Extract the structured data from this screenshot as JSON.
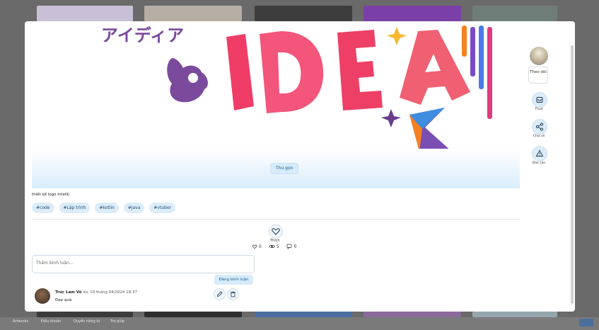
{
  "footer": {
    "links": [
      "Artworks",
      "Điều khoản",
      "Quyền riêng tư",
      "Trợ giúp"
    ]
  },
  "post": {
    "collapse_label": "Thu gọn",
    "description": "thiết kế logo intellij",
    "tags": [
      "#code",
      "#Lập trình",
      "#kotlin",
      "#java",
      "#vtuber"
    ],
    "like_label": "Thích",
    "stats": {
      "likes": "0",
      "views": "5",
      "comments": "0"
    },
    "artwork_text": {
      "japanese": "アイディア",
      "word": "IDEA"
    }
  },
  "comment_form": {
    "placeholder": "Thêm bình luận...",
    "submit_label": "Đăng bình luận"
  },
  "comments": [
    {
      "author": "Trúc Lam Võ",
      "time": "lúc 19 tháng 04/2024 18:37",
      "text": "Đẹp quá"
    }
  ],
  "sidebar": {
    "follow_label": "Theo dõi",
    "actions": [
      {
        "label": "Thuế",
        "icon": "inbox-icon"
      },
      {
        "label": "Chia sẻ",
        "icon": "share-icon"
      },
      {
        "label": "Báo cáo",
        "icon": "warning-icon"
      }
    ]
  },
  "colors": {
    "accent": "#1d5b8f",
    "chip_bg": "#dcecf8",
    "idea_pink": "#e8436b",
    "idea_red": "#f25a6e",
    "purple": "#7b4a9c"
  }
}
